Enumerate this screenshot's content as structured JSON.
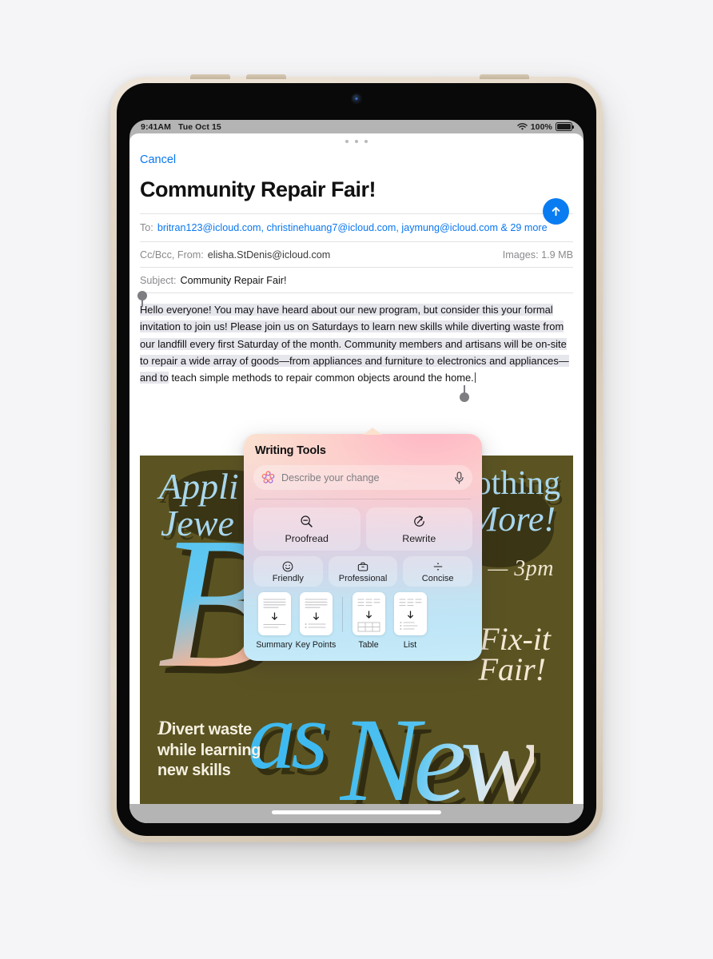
{
  "status_bar": {
    "time": "9:41AM",
    "date": "Tue Oct 15",
    "battery_percent": "100%",
    "wifi_icon": "wifi-icon",
    "battery_icon": "battery-full-icon"
  },
  "mail": {
    "cancel_label": "Cancel",
    "title": "Community Repair Fair!",
    "send_icon": "send-arrow-up-icon",
    "to": {
      "label": "To:",
      "recipients": "britran123@icloud.com, christinehuang7@icloud.com, jaymung@icloud.com & 29 more"
    },
    "from": {
      "label": "Cc/Bcc, From:",
      "value": "elisha.StDenis@icloud.com",
      "images_label": "Images:",
      "images_size": "1.9 MB"
    },
    "subject": {
      "label": "Subject:",
      "value": "Community Repair Fair!"
    },
    "body": {
      "selected_text": "Hello everyone!\nYou may have heard about our new program, but consider this your formal invitation to join us! Please join us on Saturdays to learn new skills while diverting waste from our landfill every first Saturday of the month. Community members and artisans will be on-site to repair a wide array of goods—from appliances and furniture to electronics and appliances—and to",
      "trailing_text": "teach simple methods to repair common objects around the home."
    }
  },
  "poster": {
    "line_left_1": "Appli",
    "line_left_2": "Jewe",
    "line_right_1": "lothing",
    "line_right_2": "More!",
    "time_range": "am — 3pm",
    "fix_it_1": "Fix-it",
    "fix_it_2": "Fair!",
    "big_letter": "B",
    "word_as": "as",
    "word_new": "New",
    "tagline_cap": "D",
    "tagline_rest": "ivert waste\nwhile learning\nnew skills",
    "bg_color": "#5b5422",
    "accent_blue": "#3fbaf0",
    "accent_cream": "#f4ead6"
  },
  "writing_tools": {
    "title": "Writing Tools",
    "search_placeholder": "Describe your change",
    "apple_intelligence_icon": "apple-intelligence-icon",
    "mic_icon": "microphone-icon",
    "primary_actions": [
      {
        "label": "Proofread",
        "icon": "magnifier-minus-icon"
      },
      {
        "label": "Rewrite",
        "icon": "rewrite-circular-arrow-icon"
      }
    ],
    "tone_actions": [
      {
        "label": "Friendly",
        "icon": "smiley-face-icon"
      },
      {
        "label": "Professional",
        "icon": "briefcase-icon"
      },
      {
        "label": "Concise",
        "icon": "division-sign-icon"
      }
    ],
    "document_actions": [
      {
        "label": "Summary",
        "icon": "document-summary-icon"
      },
      {
        "label": "Key Points",
        "icon": "document-key-points-icon"
      },
      {
        "label": "Table",
        "icon": "document-table-icon"
      },
      {
        "label": "List",
        "icon": "document-list-icon"
      }
    ]
  },
  "colors": {
    "accent_blue": "#0a7cf1",
    "link_blue": "#0a77ef",
    "selection": "rgba(120,120,160,0.19)"
  }
}
